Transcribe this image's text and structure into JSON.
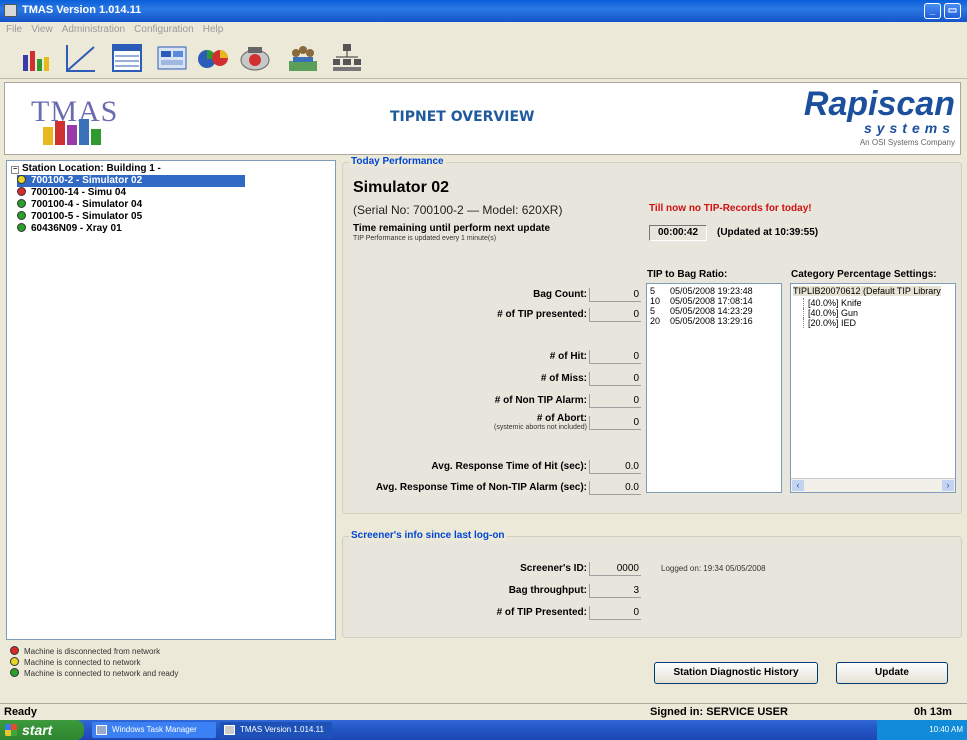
{
  "window": {
    "title": "TMAS Version 1.014.11"
  },
  "menu": [
    "File",
    "View",
    "Administration",
    "Configuration",
    "Help"
  ],
  "toolbar": [
    "bar-chart-icon",
    "line-chart-icon",
    "table-icon",
    "report-icon",
    "pie-chart-icon",
    "camera-icon",
    "users-icon",
    "org-chart-icon"
  ],
  "banner": {
    "logo_text": "TMAS",
    "title": "TIPNET OVERVIEW",
    "brand_main": "Rapiscan",
    "brand_sub": "systems",
    "brand_tag": "An OSI Systems Company"
  },
  "tree": {
    "root": "Station Location:  Building 1 -",
    "nodes": [
      {
        "label": "700100-2 - Simulator 02",
        "status": "#e8d628"
      },
      {
        "label": "700100-14 - Simu 04",
        "status": "#d62a2a"
      },
      {
        "label": "700100-4 - Simulator 04",
        "status": "#2aa02a"
      },
      {
        "label": "700100-5 - Simulator 05",
        "status": "#2aa02a"
      },
      {
        "label": "60436N09 - Xray 01",
        "status": "#2aa02a"
      }
    ]
  },
  "legend": [
    {
      "label": "Machine is disconnected from network",
      "color": "#d62a2a"
    },
    {
      "label": "Machine is connected to network",
      "color": "#e8d628"
    },
    {
      "label": "Machine is connected to network and ready",
      "color": "#2aa02a"
    }
  ],
  "today": {
    "group_title": "Today Performance",
    "station_name": "Simulator 02",
    "serial": "(Serial No: 700100-2 — Model: 620XR)",
    "warning": "Till now no TIP-Records for today!",
    "remaining_label": "Time remaining until perform next update",
    "remaining_note": "TIP Performance is updated every 1 minute(s)",
    "timer": "00:00:42",
    "updated_at": "(Updated at 10:39:55)",
    "bag_count_label": "Bag Count:",
    "bag_count": "0",
    "tip_presented_label": "# of TIP presented:",
    "tip_presented": "0",
    "hit_label": "# of Hit:",
    "hit": "0",
    "miss_label": "# of Miss:",
    "miss": "0",
    "non_tip_label": "# of Non TIP Alarm:",
    "non_tip": "0",
    "abort_label": "# of Abort:",
    "abort_note": "(systemic aborts not included)",
    "abort": "0",
    "avg_hit_label": "Avg. Response Time of Hit (sec):",
    "avg_hit": "0.0",
    "avg_non_tip_label": "Avg. Response Time of Non-TIP Alarm (sec):",
    "avg_non_tip": "0.0",
    "ratio_title": "TIP to Bag Ratio:",
    "ratio_rows": [
      {
        "ratio": "5",
        "when": "05/05/2008 19:23:48"
      },
      {
        "ratio": "10",
        "when": "05/05/2008 17:08:14"
      },
      {
        "ratio": "5",
        "when": "05/05/2008 14:23:29"
      },
      {
        "ratio": "20",
        "when": "05/05/2008 13:29:16"
      }
    ],
    "category_title": "Category Percentage Settings:",
    "category_root": "TIPLIB20070612  (Default TIP Library",
    "categories": [
      "[40.0%]  Knife",
      "[40.0%]  Gun",
      "[20.0%]  IED"
    ]
  },
  "screener": {
    "group_title": "Screener's info since last log-on",
    "id_label": "Screener's ID:",
    "id": "0000",
    "logged_on": "Logged on:  19:34  05/05/2008",
    "throughput_label": "Bag throughput:",
    "throughput": "3",
    "tip_label": "# of TIP Presented:",
    "tip": "0"
  },
  "buttons": {
    "diagnostic": "Station Diagnostic History",
    "update": "Update"
  },
  "status": {
    "left": "Ready",
    "signed_in": "Signed in: SERVICE USER",
    "elapsed": "0h 13m"
  },
  "taskbar": {
    "start": "start",
    "tasks": [
      "Windows Task Manager",
      "TMAS Version 1.014.11"
    ],
    "clock": "10:40 AM"
  }
}
